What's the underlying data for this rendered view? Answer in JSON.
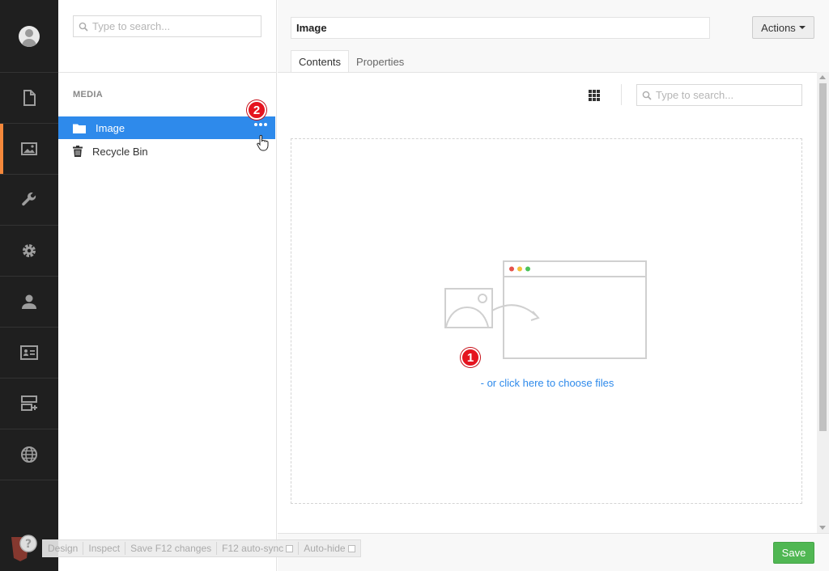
{
  "rail": {
    "items": [
      {
        "name": "content",
        "icon": "document-icon"
      },
      {
        "name": "media",
        "icon": "image-icon",
        "active": true
      },
      {
        "name": "settings",
        "icon": "wrench-icon"
      },
      {
        "name": "developer",
        "icon": "gear-icon"
      },
      {
        "name": "users",
        "icon": "user-icon"
      },
      {
        "name": "members",
        "icon": "id-card-icon"
      },
      {
        "name": "forms",
        "icon": "server-add-icon"
      },
      {
        "name": "translation",
        "icon": "globe-icon"
      }
    ],
    "accent": "#f5883b"
  },
  "tree": {
    "search_placeholder": "Type to search...",
    "section_title": "MEDIA",
    "nodes": [
      {
        "label": "Image",
        "icon": "folder-icon",
        "selected": true
      },
      {
        "label": "Recycle Bin",
        "icon": "trash-icon"
      }
    ],
    "badge": "2",
    "selected_color": "#2e8aeb"
  },
  "editor": {
    "name_value": "Image",
    "actions_label": "Actions",
    "tabs": [
      {
        "label": "Contents",
        "active": true
      },
      {
        "label": "Properties"
      }
    ],
    "search_placeholder": "Type to search...",
    "choose_files_link": "- or click here to choose files",
    "badge": "1",
    "save_label": "Save",
    "save_color": "#50b753"
  },
  "devbar": {
    "items": [
      "Design",
      "Inspect",
      "Save F12 changes",
      "F12 auto-sync",
      "Auto-hide"
    ]
  }
}
